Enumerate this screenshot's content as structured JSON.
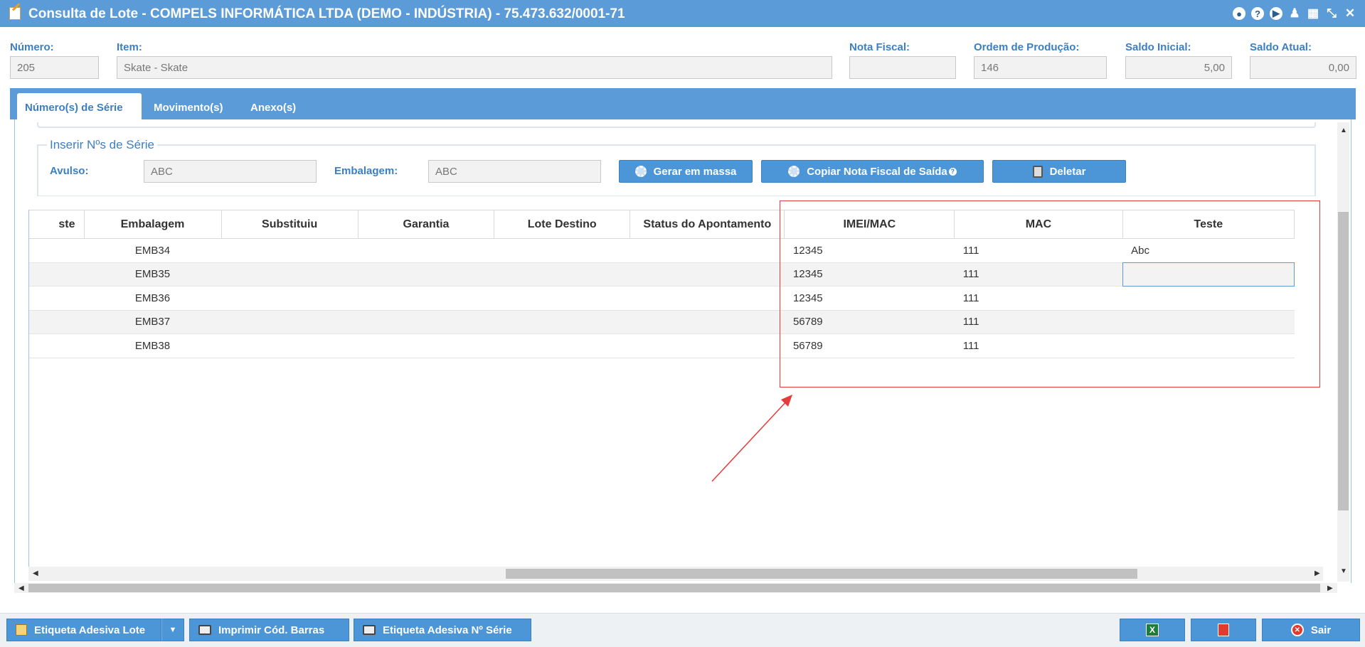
{
  "window": {
    "title": "Consulta de Lote - COMPELS INFORMÁTICA LTDA (DEMO - INDÚSTRIA) - 75.473.632/0001-71",
    "icons": [
      "record-icon",
      "help-icon",
      "play-icon",
      "bell-icon",
      "calendar-icon",
      "minimize-icon",
      "close-icon"
    ]
  },
  "header_fields": [
    {
      "label": "Número:",
      "value": "205"
    },
    {
      "label": "Item:",
      "value": "Skate - Skate"
    },
    {
      "label": "Nota Fiscal:",
      "value": ""
    },
    {
      "label": "Ordem de Produção:",
      "value": "146"
    },
    {
      "label": "Saldo Inicial:",
      "value": "5,00"
    },
    {
      "label": "Saldo Atual:",
      "value": "0,00"
    }
  ],
  "tabs": [
    "Número(s) de Série",
    "Movimento(s)",
    "Anexo(s)"
  ],
  "insert_section": {
    "legend": "Inserir Nºs de Série",
    "avulso_label": "Avulso:",
    "avulso_value": "ABC",
    "embalagem_label": "Embalagem:",
    "embalagem_value": "ABC",
    "btn_gerar": "Gerar em massa",
    "btn_copiar": "Copiar Nota Fiscal de Saída",
    "btn_deletar": "Deletar"
  },
  "grid": {
    "columns": [
      "ste",
      "Embalagem",
      "Substituiu",
      "Garantia",
      "Lote Destino",
      "Status do Apontamento",
      "IMEI/MAC",
      "MAC",
      "Teste"
    ],
    "rows": [
      {
        "embalagem": "EMB34",
        "imei": "12345",
        "mac": "111",
        "teste": "Abc"
      },
      {
        "embalagem": "EMB35",
        "imei": "12345",
        "mac": "111",
        "teste": ""
      },
      {
        "embalagem": "EMB36",
        "imei": "12345",
        "mac": "111",
        "teste": ""
      },
      {
        "embalagem": "EMB37",
        "imei": "56789",
        "mac": "111",
        "teste": ""
      },
      {
        "embalagem": "EMB38",
        "imei": "56789",
        "mac": "111",
        "teste": ""
      }
    ]
  },
  "footer": {
    "btn_etiqueta_lote": "Etiqueta Adesiva Lote",
    "btn_imprimir": "Imprimir Cód. Barras",
    "btn_etiqueta_serie": "Etiqueta Adesiva Nº Série",
    "btn_sair": "Sair",
    "excel_glyph": "X"
  },
  "colors": {
    "titlebar": "#5b9bd8",
    "accent_label": "#3c7fc1",
    "annotation": "#e53b3b"
  }
}
